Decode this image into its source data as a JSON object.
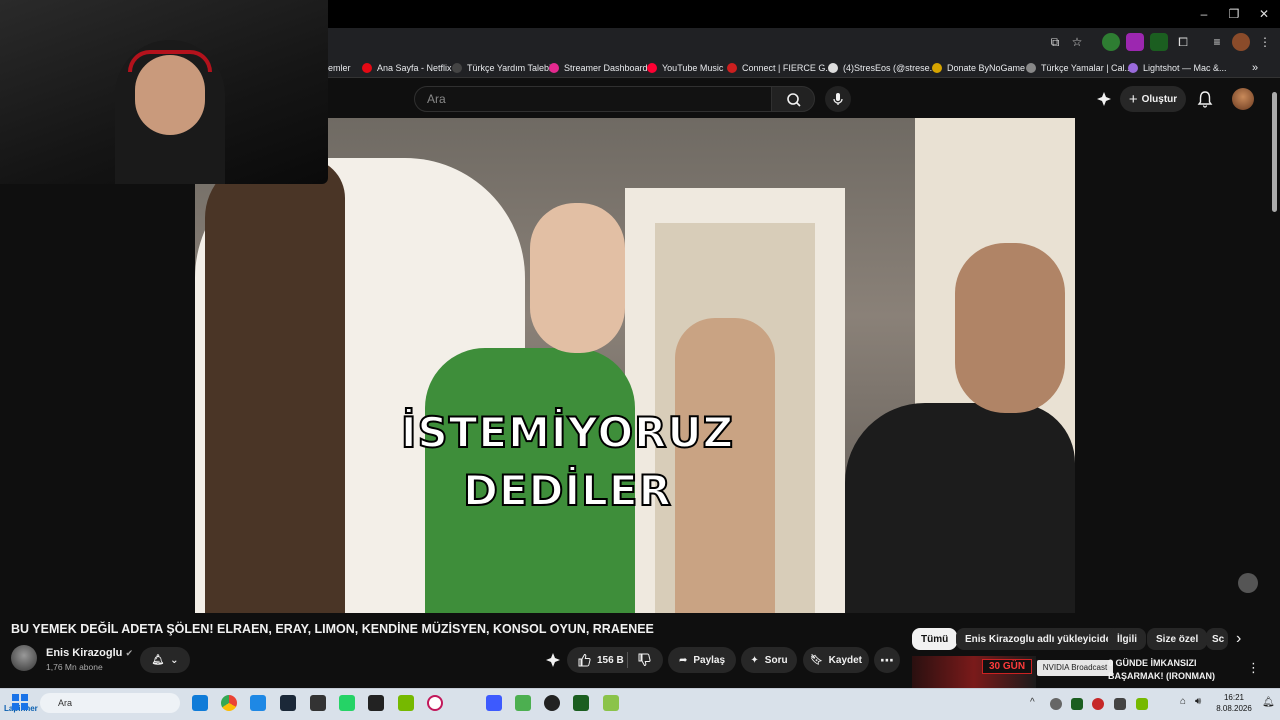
{
  "bookmarks": [
    {
      "label": "emler",
      "color": "#202124"
    },
    {
      "label": "Ana Sayfa - Netflix",
      "color": "#e50914"
    },
    {
      "label": "Türkçe Yardım Talebi",
      "color": "#444444"
    },
    {
      "label": "Streamer Dashboard",
      "color": "#e5298f"
    },
    {
      "label": "YouTube Music",
      "color": "#ff0033"
    },
    {
      "label": "Connect | FIERCE G...",
      "color": "#cc1f1f"
    },
    {
      "label": "(4)StresEos (@strese...",
      "color": "#dddddd"
    },
    {
      "label": "Donate ByNoGame",
      "color": "#d6a400"
    },
    {
      "label": "Türkçe Yamalar | Cal...",
      "color": "#888888"
    },
    {
      "label": "Lightshot — Mac &...",
      "color": "#9a6bdc"
    }
  ],
  "header": {
    "search_placeholder": "Ara",
    "create_label": "Oluştur"
  },
  "video": {
    "caption_line1": "İSTEMİYORUZ",
    "caption_line2": "DEDİLER"
  },
  "meta": {
    "title": "BU YEMEK DEĞİL ADETA ŞÖLEN! ELRAEN, ERAY, LIMON, KENDİNE MÜZİSYEN, KONSOL OYUN, RRAENEE",
    "channel_name": "Enis Kirazoglu",
    "subscribers": "1,76 Mn abone",
    "likes": "156 B",
    "share_label": "Paylaş",
    "ask_label": "Soru",
    "save_label": "Kaydet"
  },
  "chips": [
    "Tümü",
    "Enis Kirazoglu adlı yükleyiciden",
    "İlgili",
    "Size özel",
    "Sc"
  ],
  "recommendation": {
    "thumb_text": "30 GÜN",
    "title_line1": "0 GÜNDE İMKANSIZI",
    "title_line2": "BAŞARMAK! (IRONMAN)",
    "tooltip": "NVIDIA Broadcast"
  },
  "taskbar": {
    "search_text": "Ara",
    "time": "16:21",
    "date": "8.08.2026",
    "weather_label": "Lapinner"
  }
}
